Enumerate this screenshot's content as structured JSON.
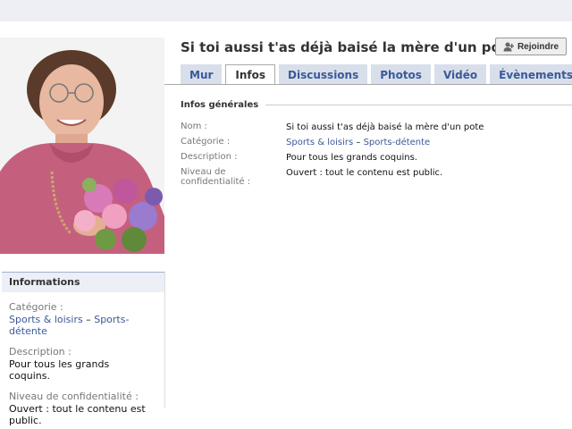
{
  "group": {
    "title": "Si toi aussi t'as déjà baisé la mère d'un pote",
    "join_label": "Rejoindre"
  },
  "tabs": [
    {
      "label": "Mur"
    },
    {
      "label": "Infos"
    },
    {
      "label": "Discussions"
    },
    {
      "label": "Photos"
    },
    {
      "label": "Vidéo"
    },
    {
      "label": "Évènements"
    }
  ],
  "info": {
    "section_title": "Infos générales",
    "name_label": "Nom :",
    "name_value": "Si toi aussi t'as déjà baisé la mère d'un pote",
    "category_label": "Catégorie :",
    "category_main": "Sports & loisirs",
    "category_sep": " – ",
    "category_sub": "Sports-détente",
    "description_label": "Description :",
    "description_value": "Pour tous les grands coquins.",
    "privacy_label": "Niveau de confidentialité :",
    "privacy_value": "Ouvert : tout le contenu est public."
  },
  "sidebar": {
    "heading": "Informations",
    "category_label": "Catégorie :",
    "category_main": "Sports & loisirs",
    "category_sep": " – ",
    "category_sub": "Sports-détente",
    "description_label": "Description :",
    "description_value": "Pour tous les grands coquins.",
    "privacy_label": "Niveau de confidentialité :",
    "privacy_value": "Ouvert : tout le contenu est public."
  },
  "colors": {
    "link": "#3b5998",
    "tab_bg": "#d8dfea",
    "header_bg": "#edeff4"
  }
}
